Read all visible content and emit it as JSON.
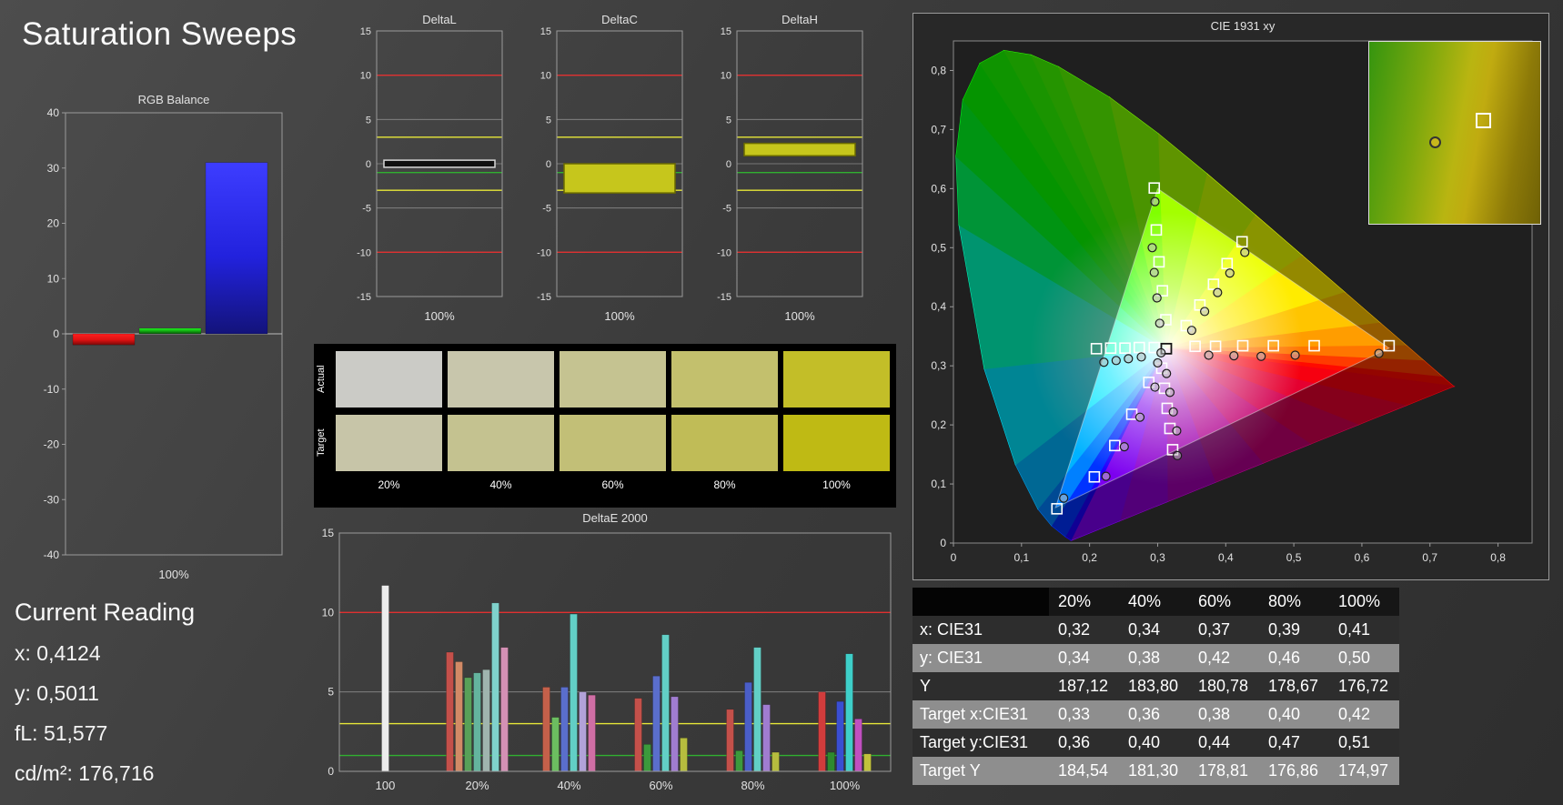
{
  "app": {
    "title": "Saturation Sweeps"
  },
  "current_reading": {
    "title": "Current Reading",
    "lines": [
      "x: 0,4124",
      "y: 0,5011",
      "fL: 51,577",
      "cd/m²: 176,716"
    ]
  },
  "swatches": {
    "row_labels": [
      "Actual",
      "Target"
    ],
    "col_labels": [
      "20%",
      "40%",
      "60%",
      "80%",
      "100%"
    ],
    "actual_colors": [
      "#cbcbc6",
      "#c8c6ac",
      "#c5c391",
      "#c3c06d",
      "#c3be28"
    ],
    "target_colors": [
      "#c7c5a8",
      "#c4c290",
      "#c2bf77",
      "#c0bc57",
      "#bfba14"
    ]
  },
  "table": {
    "headers": [
      "",
      "20%",
      "40%",
      "60%",
      "80%",
      "100%"
    ],
    "rows": [
      {
        "label": "x: CIE31",
        "values": [
          "0,32",
          "0,34",
          "0,37",
          "0,39",
          "0,41"
        ]
      },
      {
        "label": "y: CIE31",
        "values": [
          "0,34",
          "0,38",
          "0,42",
          "0,46",
          "0,50"
        ]
      },
      {
        "label": "Y",
        "values": [
          "187,12",
          "183,80",
          "180,78",
          "178,67",
          "176,72"
        ]
      },
      {
        "label": "Target x:CIE31",
        "values": [
          "0,33",
          "0,36",
          "0,38",
          "0,40",
          "0,42"
        ]
      },
      {
        "label": "Target y:CIE31",
        "values": [
          "0,36",
          "0,40",
          "0,44",
          "0,47",
          "0,51"
        ]
      },
      {
        "label": "Target Y",
        "values": [
          "184,54",
          "181,30",
          "178,81",
          "176,86",
          "174,97"
        ]
      }
    ]
  },
  "chart_data": [
    {
      "id": "rgb_balance",
      "type": "bar",
      "title": "RGB Balance",
      "categories": [
        "Red",
        "Green",
        "Blue"
      ],
      "values": [
        -2,
        1,
        31
      ],
      "colors": [
        "#dd1111",
        "#11a011",
        "#2222dd"
      ],
      "ylim": [
        -40,
        40
      ],
      "ytick_step": 10,
      "xlabel": "100%"
    },
    {
      "id": "delta_l",
      "type": "range_bar",
      "title": "DeltaL",
      "ylim": [
        -15,
        15
      ],
      "ytick_step": 5,
      "xlabel": "100%",
      "bar": {
        "from": -0.4,
        "to": 0.4,
        "fill": "#101010",
        "stroke": "#d8d8d8"
      },
      "ref_lines": [
        {
          "y": 10,
          "color": "#e03030"
        },
        {
          "y": 3,
          "color": "#e8e838"
        },
        {
          "y": -1,
          "color": "#30b030"
        },
        {
          "y": -3,
          "color": "#e8e838"
        },
        {
          "y": -10,
          "color": "#e03030"
        }
      ]
    },
    {
      "id": "delta_c",
      "type": "range_bar",
      "title": "DeltaC",
      "ylim": [
        -15,
        15
      ],
      "ytick_step": 5,
      "xlabel": "100%",
      "bar": {
        "from": 0,
        "to": -3.3,
        "fill": "#c6c61c",
        "stroke": "#6a6a00"
      },
      "ref_lines": [
        {
          "y": 10,
          "color": "#e03030"
        },
        {
          "y": 3,
          "color": "#e8e838"
        },
        {
          "y": -1,
          "color": "#30b030"
        },
        {
          "y": -3,
          "color": "#e8e838"
        },
        {
          "y": -10,
          "color": "#e03030"
        }
      ]
    },
    {
      "id": "delta_h",
      "type": "range_bar",
      "title": "DeltaH",
      "ylim": [
        -15,
        15
      ],
      "ytick_step": 5,
      "xlabel": "100%",
      "bar": {
        "from": 0.9,
        "to": 2.3,
        "fill": "#c6c61c",
        "stroke": "#6a6a00"
      },
      "ref_lines": [
        {
          "y": 10,
          "color": "#e03030"
        },
        {
          "y": 3,
          "color": "#e8e838"
        },
        {
          "y": -1,
          "color": "#30b030"
        },
        {
          "y": -3,
          "color": "#e8e838"
        },
        {
          "y": -10,
          "color": "#e03030"
        }
      ]
    },
    {
      "id": "delta_e",
      "type": "grouped_bar",
      "title": "DeltaE 2000",
      "ylim": [
        0,
        15
      ],
      "yticks": [
        0,
        5,
        10,
        15
      ],
      "ref_lines": [
        {
          "y": 10,
          "color": "#e03030"
        },
        {
          "y": 3,
          "color": "#e8e838"
        },
        {
          "y": 1,
          "color": "#30b030"
        }
      ],
      "groups": [
        {
          "label": "100",
          "bars": [
            {
              "v": 11.7,
              "c": "#ececec"
            }
          ]
        },
        {
          "label": "20%",
          "bars": [
            {
              "v": 7.5,
              "c": "#c4504a"
            },
            {
              "v": 6.9,
              "c": "#d28a66"
            },
            {
              "v": 5.9,
              "c": "#58a058"
            },
            {
              "v": 6.2,
              "c": "#64b49e"
            },
            {
              "v": 6.4,
              "c": "#9fb4ae"
            },
            {
              "v": 10.6,
              "c": "#7fd2cc"
            },
            {
              "v": 7.8,
              "c": "#d490b4"
            }
          ]
        },
        {
          "label": "40%",
          "bars": [
            {
              "v": 5.3,
              "c": "#c4604a"
            },
            {
              "v": 3.4,
              "c": "#6cbe60"
            },
            {
              "v": 5.3,
              "c": "#5a6ecc"
            },
            {
              "v": 9.9,
              "c": "#62cfc6"
            },
            {
              "v": 5.0,
              "c": "#b2a2d8"
            },
            {
              "v": 4.8,
              "c": "#cf6ea4"
            }
          ]
        },
        {
          "label": "60%",
          "bars": [
            {
              "v": 4.6,
              "c": "#c4504a"
            },
            {
              "v": 1.7,
              "c": "#3c9a3c"
            },
            {
              "v": 6.0,
              "c": "#5a6ecc"
            },
            {
              "v": 8.6,
              "c": "#62cfc6"
            },
            {
              "v": 4.7,
              "c": "#a07cd0"
            },
            {
              "v": 2.1,
              "c": "#b6bc3e"
            }
          ]
        },
        {
          "label": "80%",
          "bars": [
            {
              "v": 3.9,
              "c": "#c4504a"
            },
            {
              "v": 1.3,
              "c": "#3c9a3c"
            },
            {
              "v": 5.6,
              "c": "#4a5ec8"
            },
            {
              "v": 7.8,
              "c": "#62cfc6"
            },
            {
              "v": 4.2,
              "c": "#a07cd0"
            },
            {
              "v": 1.2,
              "c": "#b6bc3e"
            }
          ]
        },
        {
          "label": "100%",
          "bars": [
            {
              "v": 5.0,
              "c": "#d23c3c"
            },
            {
              "v": 1.2,
              "c": "#2e8a2e"
            },
            {
              "v": 4.4,
              "c": "#3a4ed2"
            },
            {
              "v": 7.4,
              "c": "#3ecfc9"
            },
            {
              "v": 3.3,
              "c": "#c050c0"
            },
            {
              "v": 1.1,
              "c": "#c2c23c"
            }
          ]
        }
      ]
    },
    {
      "id": "cie",
      "type": "scatter",
      "title": "CIE 1931 xy",
      "xlim": [
        0,
        0.85
      ],
      "ylim": [
        0,
        0.85
      ],
      "tick_labels": [
        "0",
        "0,1",
        "0,2",
        "0,3",
        "0,4",
        "0,5",
        "0,6",
        "0,7",
        "0,8"
      ],
      "gamut_triangle": [
        [
          0.64,
          0.33
        ],
        [
          0.3,
          0.6
        ],
        [
          0.15,
          0.06
        ]
      ],
      "white_point": [
        0.3127,
        0.329
      ],
      "target_squares": [
        [
          0.355,
          0.333
        ],
        [
          0.385,
          0.333
        ],
        [
          0.425,
          0.334
        ],
        [
          0.47,
          0.334
        ],
        [
          0.53,
          0.334
        ],
        [
          0.64,
          0.334
        ],
        [
          0.295,
          0.331
        ],
        [
          0.273,
          0.331
        ],
        [
          0.252,
          0.33
        ],
        [
          0.231,
          0.33
        ],
        [
          0.21,
          0.329
        ],
        [
          0.312,
          0.378
        ],
        [
          0.307,
          0.427
        ],
        [
          0.302,
          0.476
        ],
        [
          0.298,
          0.53
        ],
        [
          0.295,
          0.601
        ],
        [
          0.287,
          0.272
        ],
        [
          0.262,
          0.218
        ],
        [
          0.237,
          0.165
        ],
        [
          0.207,
          0.112
        ],
        [
          0.152,
          0.058
        ],
        [
          0.342,
          0.368
        ],
        [
          0.362,
          0.403
        ],
        [
          0.382,
          0.438
        ],
        [
          0.402,
          0.473
        ],
        [
          0.424,
          0.51
        ],
        [
          0.306,
          0.296
        ],
        [
          0.31,
          0.262
        ],
        [
          0.314,
          0.228
        ],
        [
          0.318,
          0.194
        ],
        [
          0.322,
          0.158
        ]
      ],
      "measured_circles": [
        [
          0.375,
          0.318
        ],
        [
          0.412,
          0.317
        ],
        [
          0.452,
          0.316
        ],
        [
          0.502,
          0.318
        ],
        [
          0.625,
          0.321
        ],
        [
          0.276,
          0.315
        ],
        [
          0.257,
          0.312
        ],
        [
          0.239,
          0.309
        ],
        [
          0.221,
          0.306
        ],
        [
          0.303,
          0.372
        ],
        [
          0.299,
          0.415
        ],
        [
          0.295,
          0.458
        ],
        [
          0.292,
          0.5
        ],
        [
          0.296,
          0.578
        ],
        [
          0.296,
          0.264
        ],
        [
          0.274,
          0.213
        ],
        [
          0.251,
          0.163
        ],
        [
          0.224,
          0.113
        ],
        [
          0.162,
          0.076
        ],
        [
          0.35,
          0.36
        ],
        [
          0.369,
          0.392
        ],
        [
          0.388,
          0.424
        ],
        [
          0.406,
          0.457
        ],
        [
          0.428,
          0.492
        ],
        [
          0.313,
          0.287
        ],
        [
          0.318,
          0.255
        ],
        [
          0.323,
          0.222
        ],
        [
          0.328,
          0.19
        ],
        [
          0.329,
          0.148
        ],
        [
          0.305,
          0.322
        ],
        [
          0.3,
          0.305
        ]
      ]
    }
  ]
}
